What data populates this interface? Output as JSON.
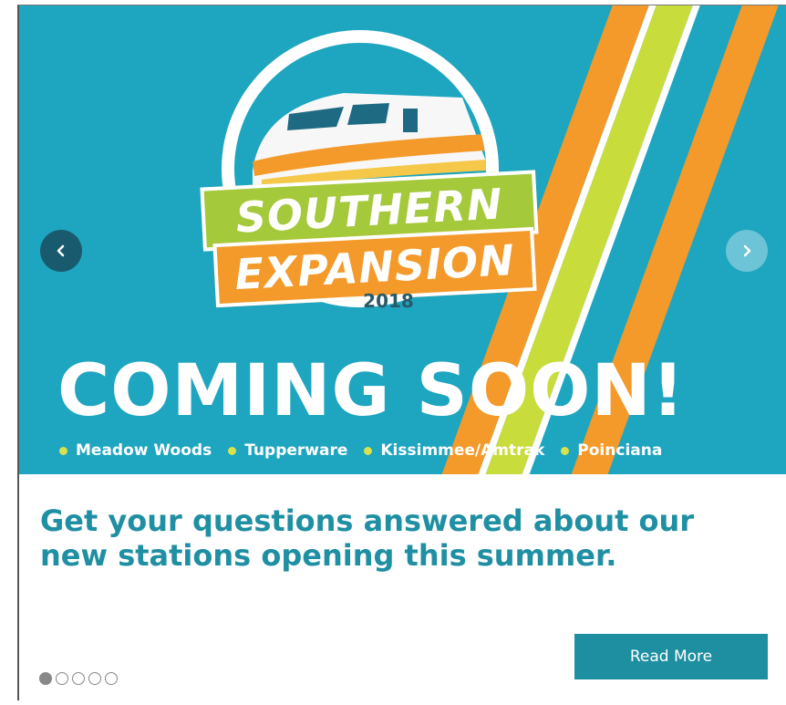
{
  "slide": {
    "logo": {
      "line1": "SOUTHERN",
      "line2": "EXPANSION",
      "year": "2018"
    },
    "heading": "COMING SOON!",
    "stations": [
      "Meadow Woods",
      "Tupperware",
      "Kissimmee/Amtrak",
      "Poinciana"
    ],
    "colors": {
      "background": "#1ea5c0",
      "orange": "#f39a2a",
      "lime": "#c8dc3c",
      "green": "#a4c93a",
      "dot": "#d9e24a"
    }
  },
  "caption": {
    "headline": "Get your questions answered about our new stations opening this summer.",
    "button_label": "Read More"
  },
  "carousel": {
    "prev_icon": "chevron-left-icon",
    "next_icon": "chevron-right-icon",
    "slide_count": 5,
    "active_index": 0
  }
}
